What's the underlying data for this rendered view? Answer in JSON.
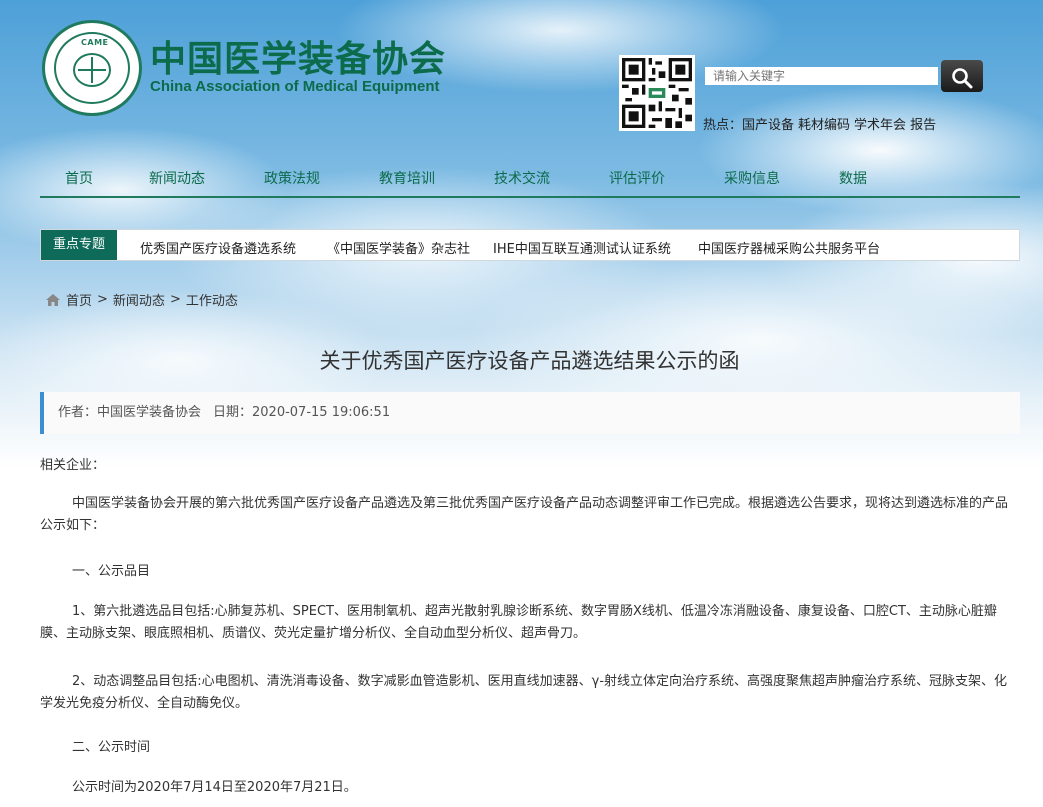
{
  "colors": {
    "brand_green": "#0c6b4b",
    "topic_bg": "#0e6b5a",
    "meta_accent": "#3b8ed0"
  },
  "header": {
    "brand_cn": "中国医学装备协会",
    "brand_en": "China Association of Medical Equipment",
    "seal_mark": "CAME",
    "search_placeholder": "请输入关键字",
    "search_icon": "search-icon",
    "hot_label": "热点：",
    "hot_links": [
      "国产设备",
      "耗材编码",
      "学术年会",
      "报告"
    ]
  },
  "nav": {
    "items": [
      "首页",
      "新闻动态",
      "政策法规",
      "教育培训",
      "技术交流",
      "评估评价",
      "采购信息",
      "数据"
    ]
  },
  "topics": {
    "label": "重点专题",
    "links": [
      "优秀国产医疗设备遴选系统",
      "《中国医学装备》杂志社",
      "IHE中国互联互通测试认证系统",
      "中国医疗器械采购公共服务平台"
    ]
  },
  "breadcrumb": {
    "icon": "home-icon",
    "items": [
      "首页",
      "新闻动态",
      "工作动态"
    ],
    "separator": ">"
  },
  "article": {
    "title": "关于优秀国产医疗设备产品遴选结果公示的函",
    "author": "作者：中国医学装备协会",
    "date": "日期：2020-07-15 19:06:51",
    "paragraphs": [
      "相关企业：",
      "中国医学装备协会开展的第六批优秀国产医疗设备产品遴选及第三批优秀国产医疗设备产品动态调整评审工作已完成。根据遴选公告要求，现将达到遴选标准的产品公示如下：",
      "一、公示品目",
      "1、第六批遴选品目包括:心肺复苏机、SPECT、医用制氧机、超声光散射乳腺诊断系统、数字胃肠X线机、低温冷冻消融设备、康复设备、口腔CT、主动脉心脏瓣膜、主动脉支架、眼底照相机、质谱仪、荧光定量扩增分析仪、全自动血型分析仪、超声骨刀。",
      "2、动态调整品目包括:心电图机、清洗消毒设备、数字减影血管造影机、医用直线加速器、γ-射线立体定向治疗系统、高强度聚焦超声肿瘤治疗系统、冠脉支架、化学发光免疫分析仪、全自动酶免仪。",
      "二、公示时间",
      "公示时间为2020年7月14日至2020年7月21日。"
    ]
  }
}
